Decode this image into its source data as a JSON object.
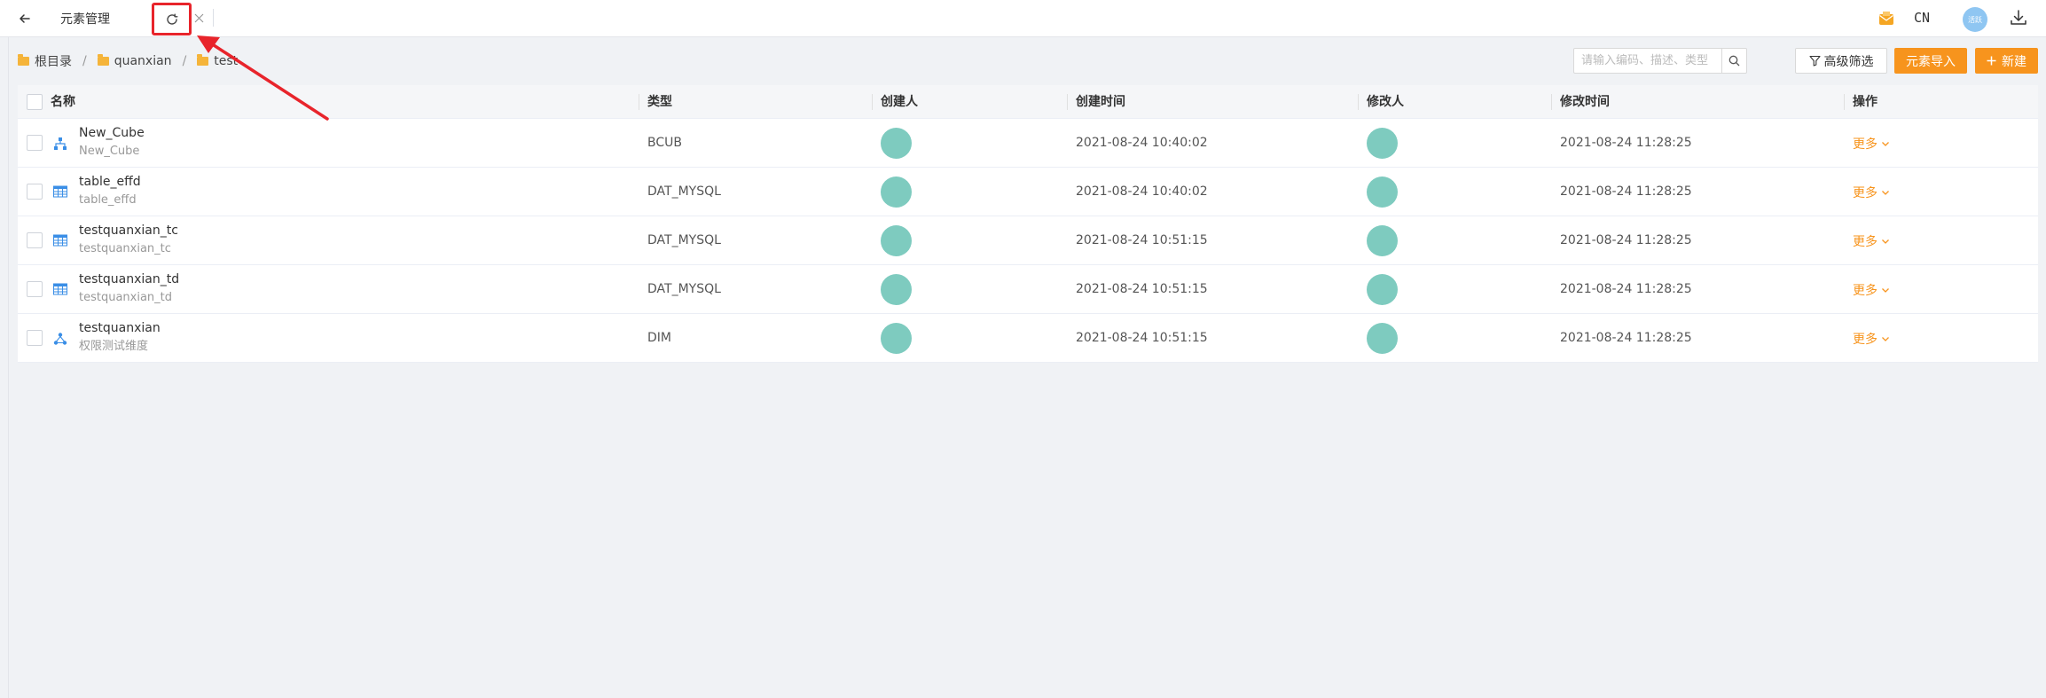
{
  "topbar": {
    "back_icon": "arrow-left-icon",
    "tab_title": "元素管理",
    "refresh_icon": "refresh-icon",
    "close_icon": "close-icon",
    "message_icon": "envelope-icon",
    "language": "CN",
    "avatar_text": "活跃",
    "download_icon": "download-icon"
  },
  "breadcrumb": [
    "根目录",
    "quanxian",
    "test"
  ],
  "toolbar": {
    "search_placeholder": "请输入编码、描述、类型",
    "search_icon": "search-icon",
    "filter_label": "高级筛选",
    "filter_icon": "filter-icon",
    "import_label": "元素导入",
    "new_label": "新建",
    "new_icon": "plus-icon"
  },
  "table": {
    "columns": [
      "名称",
      "类型",
      "创建人",
      "创建时间",
      "修改人",
      "修改时间",
      "操作"
    ],
    "rows": [
      {
        "name": "New_Cube",
        "desc": "New_Cube",
        "type": "BCUB",
        "created": "2021-08-24 10:40:02",
        "modified": "2021-08-24 11:28:25",
        "action": "更多",
        "icon": "cube-hierarchy-icon"
      },
      {
        "name": "table_effd",
        "desc": "table_effd",
        "type": "DAT_MYSQL",
        "created": "2021-08-24 10:40:02",
        "modified": "2021-08-24 11:28:25",
        "action": "更多",
        "icon": "table-icon"
      },
      {
        "name": "testquanxian_tc",
        "desc": "testquanxian_tc",
        "type": "DAT_MYSQL",
        "created": "2021-08-24 10:51:15",
        "modified": "2021-08-24 11:28:25",
        "action": "更多",
        "icon": "table-icon"
      },
      {
        "name": "testquanxian_td",
        "desc": "testquanxian_td",
        "type": "DAT_MYSQL",
        "created": "2021-08-24 10:51:15",
        "modified": "2021-08-24 11:28:25",
        "action": "更多",
        "icon": "table-icon"
      },
      {
        "name": "testquanxian",
        "desc": "权限测试维度",
        "type": "DIM",
        "created": "2021-08-24 10:51:15",
        "modified": "2021-08-24 11:28:25",
        "action": "更多",
        "icon": "dimension-icon"
      }
    ]
  },
  "colors": {
    "accent": "#f7941d",
    "avatar_teal": "#7ecbbf",
    "annotation_red": "#e8242b",
    "icon_blue": "#3a8ee6"
  }
}
